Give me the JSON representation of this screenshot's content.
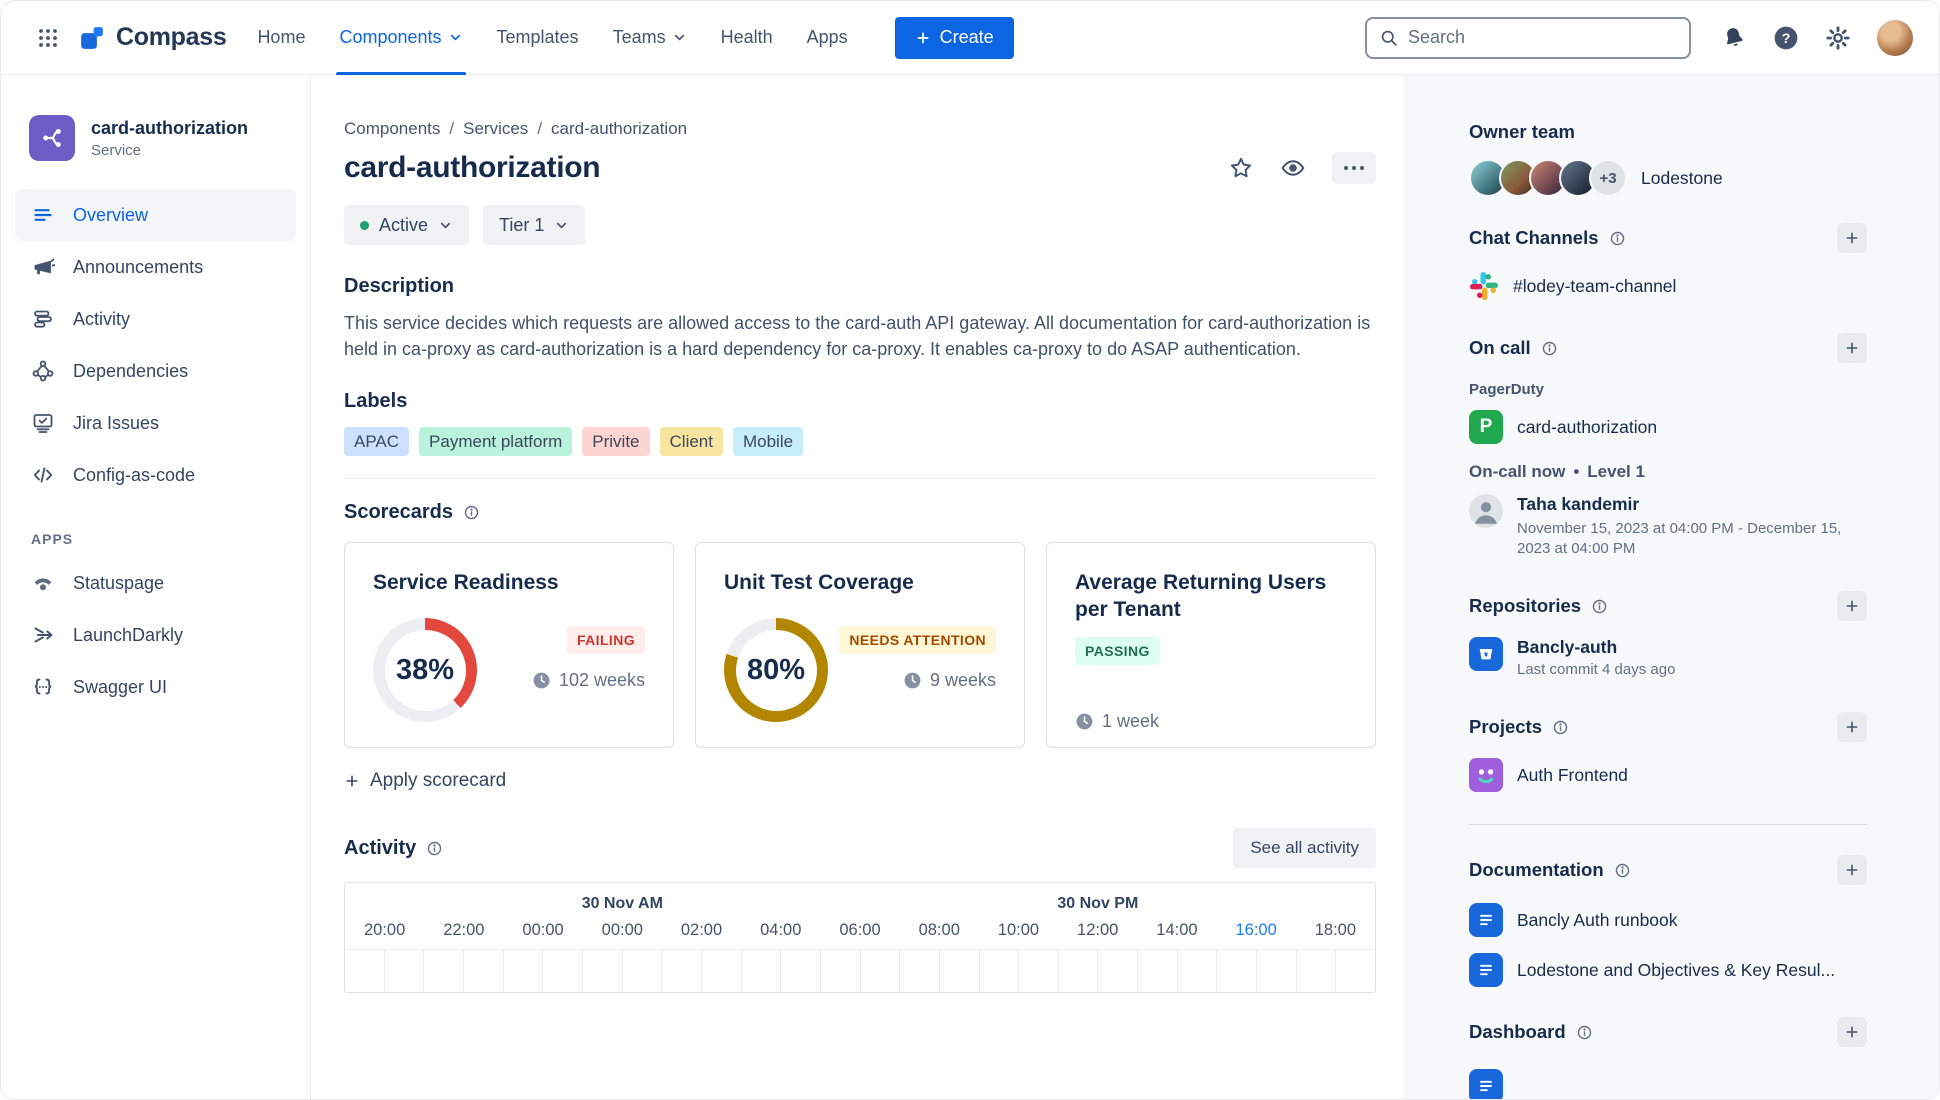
{
  "nav": {
    "brand": "Compass",
    "items": [
      {
        "label": "Home",
        "active": false,
        "has_chevron": false
      },
      {
        "label": "Components",
        "active": true,
        "has_chevron": true
      },
      {
        "label": "Templates",
        "active": false,
        "has_chevron": false
      },
      {
        "label": "Teams",
        "active": false,
        "has_chevron": true
      },
      {
        "label": "Health",
        "active": false,
        "has_chevron": false
      },
      {
        "label": "Apps",
        "active": false,
        "has_chevron": false
      }
    ],
    "create_label": "Create",
    "search": {
      "placeholder": "Search"
    }
  },
  "sidebar": {
    "component": {
      "name": "card-authorization",
      "type": "Service"
    },
    "items": [
      {
        "label": "Overview",
        "active": true
      },
      {
        "label": "Announcements",
        "active": false
      },
      {
        "label": "Activity",
        "active": false
      },
      {
        "label": "Dependencies",
        "active": false
      },
      {
        "label": "Jira Issues",
        "active": false
      },
      {
        "label": "Config-as-code",
        "active": false
      }
    ],
    "apps_heading": "APPS",
    "apps": [
      {
        "label": "Statuspage"
      },
      {
        "label": "LaunchDarkly"
      },
      {
        "label": "Swagger UI"
      }
    ]
  },
  "main": {
    "breadcrumb": {
      "items": [
        "Components",
        "Services",
        "card-authorization"
      ],
      "separator": "/"
    },
    "title": "card-authorization",
    "status_pill": {
      "label": "Active",
      "dot_color": "#22A06B"
    },
    "tier_pill": {
      "label": "Tier 1"
    },
    "description": {
      "heading": "Description",
      "text": "This service decides which requests are allowed access to the card-auth API gateway. All documentation for card-authorization is held in ca-proxy as card-authorization is a hard dependency for ca-proxy. It enables ca-proxy to do ASAP authentication."
    },
    "labels": {
      "heading": "Labels",
      "tags": [
        {
          "text": "APAC",
          "bg": "#CCE0FF"
        },
        {
          "text": "Payment platform",
          "bg": "#BAF3DB"
        },
        {
          "text": "Privite",
          "bg": "#FFD5D2"
        },
        {
          "text": "Client",
          "bg": "#F8E6A0"
        },
        {
          "text": "Mobile",
          "bg": "#C6EDFB"
        }
      ]
    },
    "scorecards": {
      "heading": "Scorecards",
      "apply_label": "Apply scorecard",
      "cards": [
        {
          "title": "Service Readiness",
          "value": 38,
          "percent_label": "38%",
          "ring_color": "#E2483D",
          "status": "FAILING",
          "status_fg": "#C9372C",
          "status_bg": "#FFECEB",
          "age": "102 weeks"
        },
        {
          "title": "Unit Test Coverage",
          "value": 80,
          "percent_label": "80%",
          "ring_color": "#B38600",
          "status": "NEEDS ATTENTION",
          "status_fg": "#A54800",
          "status_bg": "#FFF7D6",
          "age": "9 weeks"
        },
        {
          "title": "Average Returning Users per Tenant",
          "status": "PASSING",
          "status_fg": "#216E4E",
          "status_bg": "#DCFFF1",
          "age": "1 week"
        }
      ]
    },
    "activity": {
      "heading": "Activity",
      "see_all_label": "See all activity",
      "day_groups": [
        {
          "label": "30 Nov AM",
          "tick_index": 3
        },
        {
          "label": "30 Nov PM",
          "tick_index": 9
        }
      ],
      "ticks": [
        "20:00",
        "22:00",
        "00:00",
        "00:00",
        "02:00",
        "04:00",
        "06:00",
        "08:00",
        "10:00",
        "12:00",
        "14:00",
        "16:00",
        "18:00"
      ],
      "highlight_index": 11,
      "highlight_color": "#1D7AFC",
      "grid_columns": 26
    }
  },
  "aside": {
    "owner_team": {
      "heading": "Owner team",
      "overflow_badge": "+3",
      "team_name": "Lodestone",
      "avatar_count": 4
    },
    "chat": {
      "heading": "Chat Channels",
      "channel": "#lodey-team-channel"
    },
    "on_call": {
      "heading": "On call",
      "provider_label": "PagerDuty",
      "provider_monogram": "P",
      "service": "card-authorization",
      "now_label": "On-call now",
      "separator": "•",
      "level": "Level 1",
      "person": "Taha kandemir",
      "schedule": "November 15, 2023 at 04:00 PM - December 15, 2023 at 04:00 PM"
    },
    "repositories": {
      "heading": "Repositories",
      "name": "Bancly-auth",
      "meta": "Last commit 4 days ago"
    },
    "projects": {
      "heading": "Projects",
      "name": "Auth Frontend"
    },
    "documentation": {
      "heading": "Documentation",
      "items": [
        {
          "title": "Bancly Auth runbook"
        },
        {
          "title": "Lodestone and Objectives & Key Resul..."
        }
      ]
    },
    "dashboard": {
      "heading": "Dashboard"
    }
  },
  "icons": {
    "app-switcher": "grid-dots",
    "search": "magnifier",
    "notifications": "bell",
    "help": "question-circle",
    "settings": "gear",
    "favorite": "star",
    "watch": "eye",
    "more": "ellipsis",
    "info": "info-circle",
    "clock": "clock-filled",
    "add": "plus",
    "chevron": "chevron-down",
    "chat": "slack-pinwheel",
    "repository": "bucket",
    "document": "page-lines",
    "component": "share-nodes"
  },
  "colors": {
    "accent": "#0C66E4",
    "status_dot": "#22A06B",
    "donut_track": "#EDEEF1",
    "pagerduty_green": "#1FA84C",
    "doc_blue": "#1868DB",
    "component_purple": "#6E5DC6",
    "aside_bg": "#F7F8F9"
  }
}
